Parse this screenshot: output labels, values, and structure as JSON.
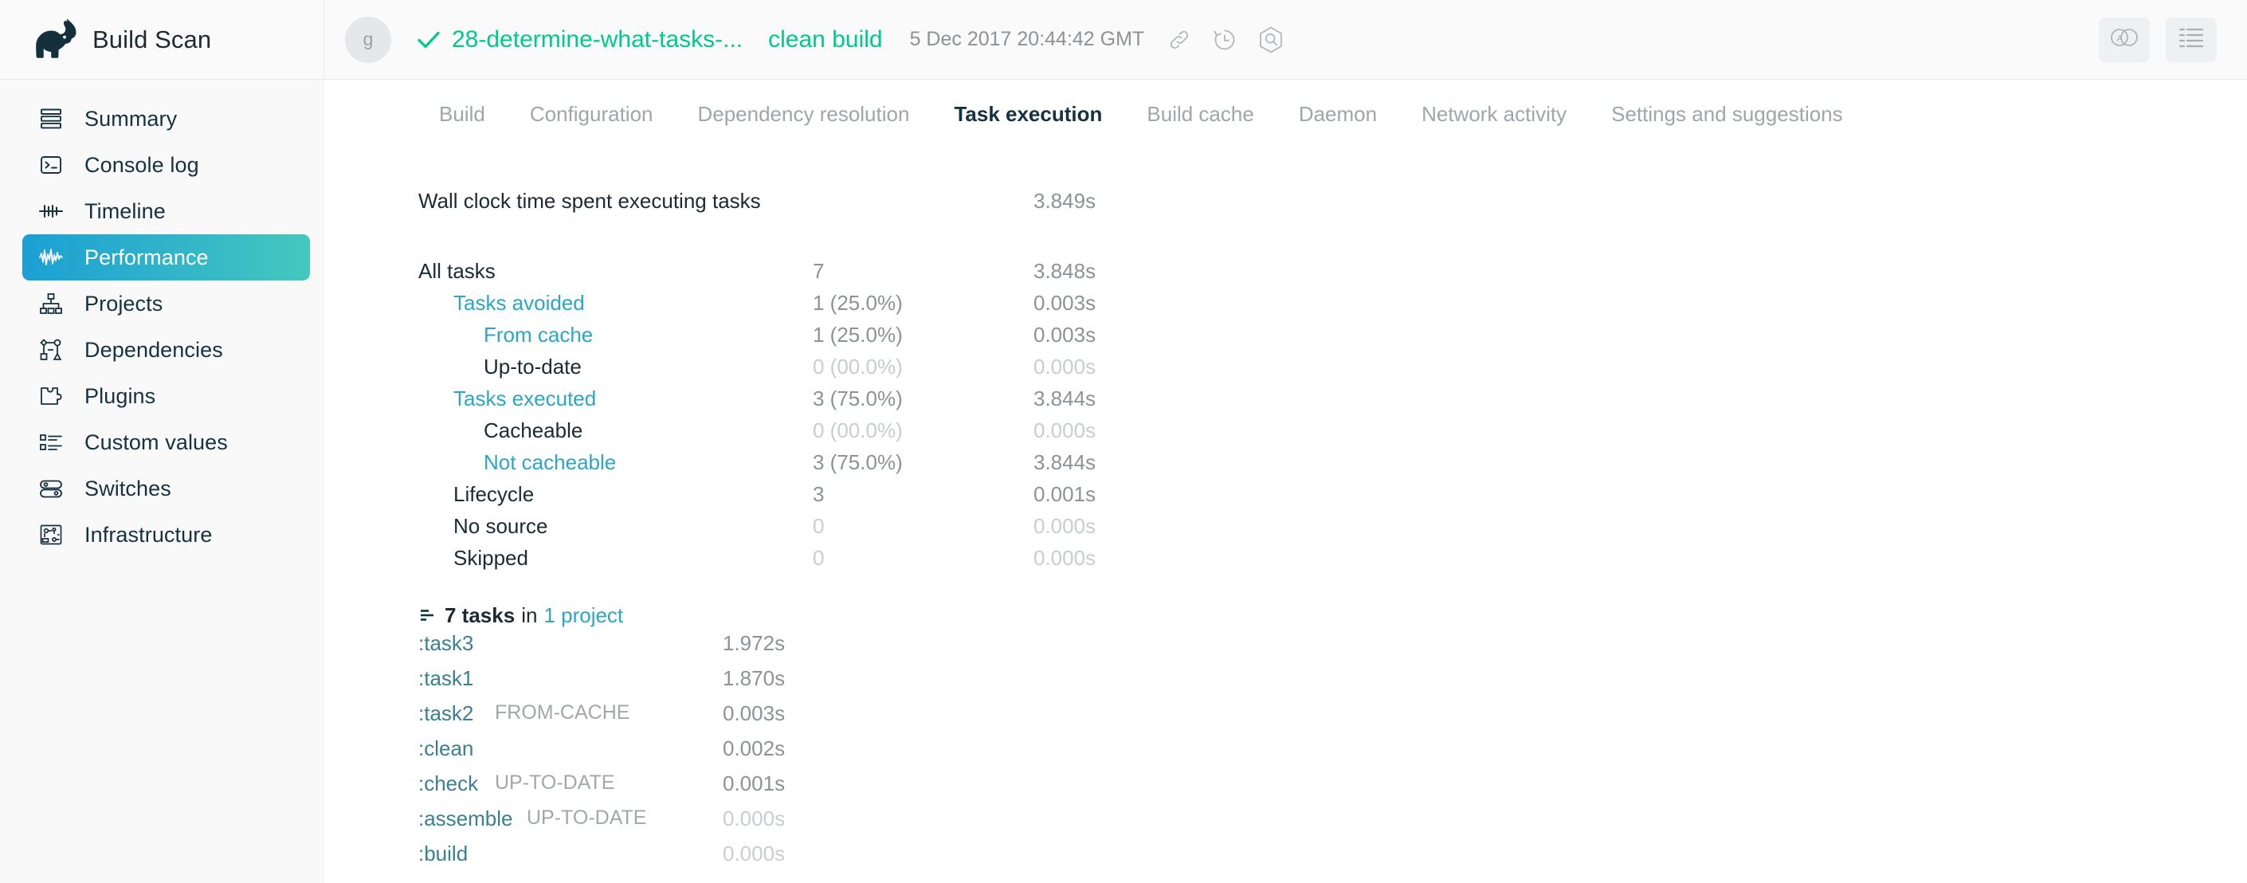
{
  "brand": {
    "name": "Build Scan",
    "logo_icon": "elephant-logo-icon"
  },
  "header": {
    "avatar_initial": "g",
    "status_icon": "check-icon",
    "scan_title": "28-determine-what-tasks-...",
    "scan_tasks": "clean build",
    "timestamp": "5 Dec 2017 20:44:42 GMT",
    "icons": [
      "link-icon",
      "history-icon",
      "search-scan-icon"
    ],
    "right_buttons": [
      "compare-icon",
      "list-menu-icon"
    ],
    "accent_green": "#00c98c"
  },
  "sidebar": {
    "active": "Performance",
    "items": [
      {
        "label": "Summary",
        "icon": "summary-icon"
      },
      {
        "label": "Console log",
        "icon": "console-icon"
      },
      {
        "label": "Timeline",
        "icon": "timeline-icon"
      },
      {
        "label": "Performance",
        "icon": "performance-icon"
      },
      {
        "label": "Projects",
        "icon": "projects-icon"
      },
      {
        "label": "Dependencies",
        "icon": "dependencies-icon"
      },
      {
        "label": "Plugins",
        "icon": "plugins-icon"
      },
      {
        "label": "Custom values",
        "icon": "custom-values-icon"
      },
      {
        "label": "Switches",
        "icon": "switches-icon"
      },
      {
        "label": "Infrastructure",
        "icon": "infrastructure-icon"
      }
    ],
    "gradient_from": "#1b9fd4",
    "gradient_to": "#45c8be"
  },
  "tabs": [
    {
      "label": "Build",
      "active": false
    },
    {
      "label": "Configuration",
      "active": false
    },
    {
      "label": "Dependency resolution",
      "active": false
    },
    {
      "label": "Task execution",
      "active": true
    },
    {
      "label": "Build cache",
      "active": false
    },
    {
      "label": "Daemon",
      "active": false
    },
    {
      "label": "Network activity",
      "active": false
    },
    {
      "label": "Settings and suggestions",
      "active": false
    }
  ],
  "summary": {
    "wall_clock": {
      "label": "Wall clock time spent executing tasks",
      "count": "",
      "duration": "3.849s"
    },
    "rows": [
      {
        "label": "All tasks",
        "indent": 0,
        "style": "dark",
        "count": "7",
        "count_style": "grey",
        "duration": "3.848s",
        "dur_style": "grey"
      },
      {
        "label": "Tasks avoided",
        "indent": 1,
        "style": "link",
        "count": "1 (25.0%)",
        "count_style": "grey",
        "duration": "0.003s",
        "dur_style": "grey"
      },
      {
        "label": "From cache",
        "indent": 2,
        "style": "link",
        "count": "1 (25.0%)",
        "count_style": "grey",
        "duration": "0.003s",
        "dur_style": "grey"
      },
      {
        "label": "Up-to-date",
        "indent": 2,
        "style": "dark",
        "count": "0 (00.0%)",
        "count_style": "faint",
        "duration": "0.000s",
        "dur_style": "faint"
      },
      {
        "label": "Tasks executed",
        "indent": 1,
        "style": "link",
        "count": "3 (75.0%)",
        "count_style": "grey",
        "duration": "3.844s",
        "dur_style": "grey"
      },
      {
        "label": "Cacheable",
        "indent": 2,
        "style": "dark",
        "count": "0 (00.0%)",
        "count_style": "faint",
        "duration": "0.000s",
        "dur_style": "faint"
      },
      {
        "label": "Not cacheable",
        "indent": 2,
        "style": "link",
        "count": "3 (75.0%)",
        "count_style": "grey",
        "duration": "3.844s",
        "dur_style": "grey"
      },
      {
        "label": "Lifecycle",
        "indent": 1,
        "style": "dark",
        "count": "3",
        "count_style": "grey",
        "duration": "0.001s",
        "dur_style": "grey"
      },
      {
        "label": "No source",
        "indent": 1,
        "style": "dark",
        "count": "0",
        "count_style": "faint",
        "duration": "0.000s",
        "dur_style": "faint"
      },
      {
        "label": "Skipped",
        "indent": 1,
        "style": "dark",
        "count": "0",
        "count_style": "faint",
        "duration": "0.000s",
        "dur_style": "faint"
      }
    ]
  },
  "tasks_section": {
    "sort_icon": "sort-lines-icon",
    "heading_count": "7 tasks",
    "heading_in": "in",
    "heading_project": "1 project",
    "rows": [
      {
        "name": ":task3",
        "badge": "",
        "duration": "1.972s",
        "dur_style": "grey"
      },
      {
        "name": ":task1",
        "badge": "",
        "duration": "1.870s",
        "dur_style": "grey"
      },
      {
        "name": ":task2",
        "badge": "FROM-CACHE",
        "duration": "0.003s",
        "dur_style": "grey"
      },
      {
        "name": ":clean",
        "badge": "",
        "duration": "0.002s",
        "dur_style": "grey"
      },
      {
        "name": ":check",
        "badge": "UP-TO-DATE",
        "duration": "0.001s",
        "dur_style": "grey"
      },
      {
        "name": ":assemble",
        "badge": "UP-TO-DATE",
        "duration": "0.000s",
        "dur_style": "faint"
      },
      {
        "name": ":build",
        "badge": "",
        "duration": "0.000s",
        "dur_style": "faint"
      }
    ]
  }
}
